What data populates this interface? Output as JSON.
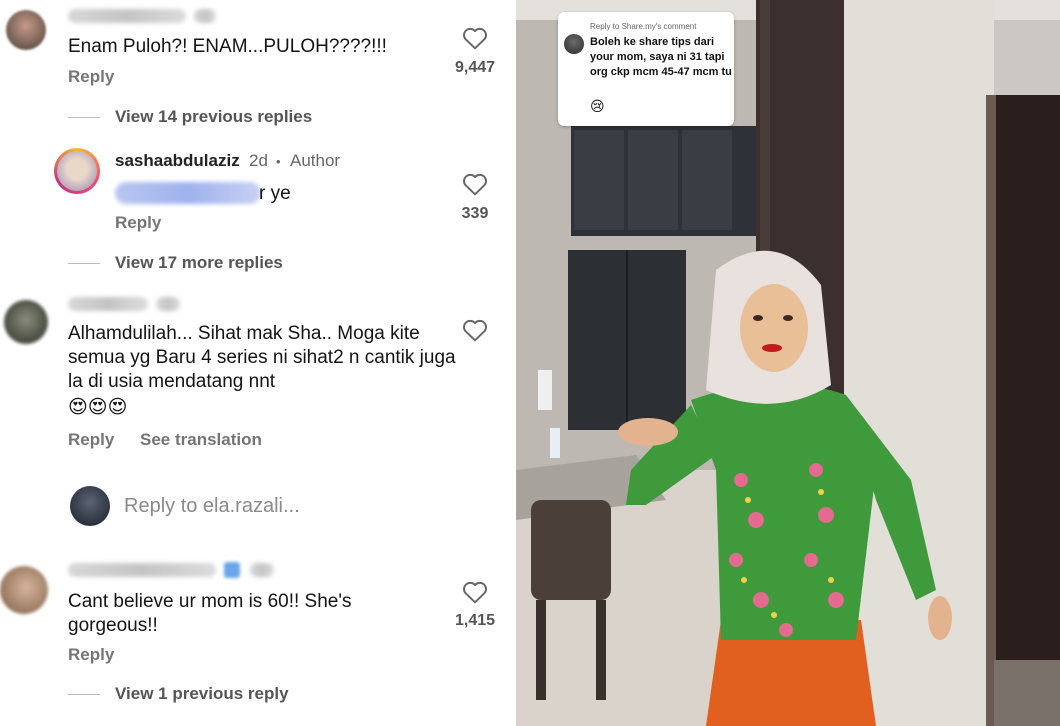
{
  "comments": [
    {
      "text": "Enam Puloh?! ENAM...PULOH????!!!",
      "reply_label": "Reply",
      "likes": "9,447"
    },
    {
      "text": "Alhamdulilah... Sihat mak Sha.. Moga kite semua yg Baru 4 series ni sihat2 n cantik juga la di usia mendatang nnt",
      "emojis": "😍😍😍",
      "reply_label": "Reply",
      "translate_label": "See translation"
    },
    {
      "text": "Cant believe ur mom is 60!! She's gorgeous!!",
      "reply_label": "Reply",
      "likes": "1,415"
    }
  ],
  "thread1": {
    "view_previous": "View 14 previous replies",
    "view_more": "View 17 more replies"
  },
  "author_reply": {
    "username": "sashaabdulaziz",
    "time": "2d",
    "separator": "•",
    "badge": "Author",
    "text_suffix": "r ye",
    "reply_label": "Reply",
    "likes": "339"
  },
  "reply_input": {
    "placeholder": "Reply to ela.razali..."
  },
  "thread3": {
    "view_previous": "View 1 previous reply"
  },
  "video": {
    "bubble_header": "Reply to Share.my's comment",
    "bubble_text": "Boleh ke share tips dari your mom, saya ni 31 tapi org ckp mcm 45-47 mcm tu",
    "bubble_emoji": "😢"
  },
  "colors": {
    "text_primary": "#141414",
    "text_secondary": "#757575",
    "kebaya_green": "#3f9a3b",
    "skirt_orange": "#e2601f"
  }
}
